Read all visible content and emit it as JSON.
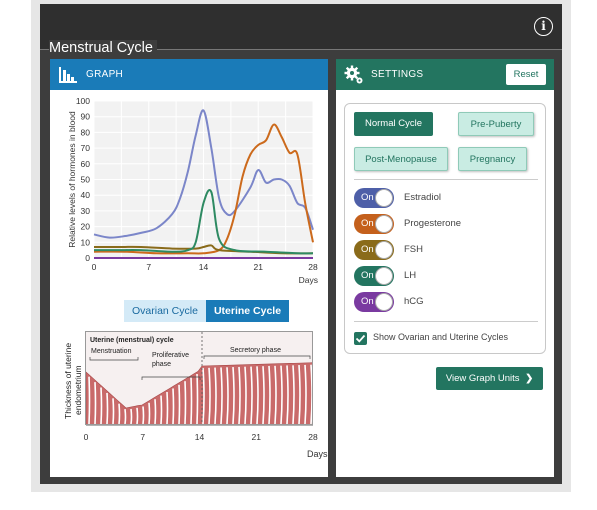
{
  "app": {
    "title": "Menstrual Cycle",
    "info_icon": "info-icon"
  },
  "graph_panel": {
    "header": "GRAPH",
    "icon": "bar-chart-icon",
    "tabs": [
      {
        "label": "Ovarian Cycle",
        "active": false
      },
      {
        "label": "Uterine Cycle",
        "active": true
      }
    ],
    "uterine_figure": {
      "title": "Uterine (menstrual) cycle",
      "phases": [
        "Menstruation",
        "Proliferative phase",
        "Secretory phase"
      ],
      "ylabel_line1": "Thickness of uterine",
      "ylabel_line2": "endometrium",
      "x_ticks": [
        "0",
        "7",
        "14",
        "21",
        "28"
      ],
      "xlabel": "Days"
    }
  },
  "chart_data": {
    "type": "line",
    "ylabel": "Relative levels of hormones in blood",
    "xlabel": "Days",
    "xlim": [
      0,
      28
    ],
    "ylim": [
      0,
      100
    ],
    "x_ticks": [
      0,
      7,
      14,
      21,
      28
    ],
    "y_ticks": [
      0,
      10,
      20,
      30,
      40,
      50,
      60,
      70,
      80,
      90,
      100
    ],
    "grid": true,
    "series": [
      {
        "color": "#7b86c9",
        "x": [
          0,
          2,
          4,
          6,
          8,
          10,
          11,
          12,
          13,
          14,
          15,
          16,
          17,
          18,
          20,
          21,
          22,
          23,
          24,
          25,
          26,
          27,
          28
        ],
        "y": [
          15,
          13,
          14,
          16,
          19,
          28,
          38,
          55,
          78,
          94,
          70,
          38,
          28,
          30,
          45,
          56,
          48,
          50,
          50,
          46,
          35,
          32,
          18
        ]
      },
      {
        "color": "#cc6a1c",
        "x": [
          0,
          4,
          8,
          12,
          14,
          16,
          17,
          18,
          19,
          20,
          21,
          22,
          23,
          24,
          25,
          26,
          27,
          28
        ],
        "y": [
          4,
          4,
          3,
          3,
          3,
          5,
          12,
          28,
          52,
          66,
          72,
          75,
          85,
          77,
          67,
          66,
          35,
          10
        ]
      },
      {
        "color": "#8a6b1a",
        "x": [
          0,
          3,
          6,
          10,
          13,
          14,
          15,
          16,
          20,
          24,
          28
        ],
        "y": [
          7,
          7,
          7,
          6,
          6,
          7,
          8,
          5,
          4,
          3,
          3
        ]
      },
      {
        "color": "#2e8a62",
        "x": [
          0,
          3,
          6,
          10,
          12,
          13,
          14,
          15,
          16,
          18,
          22,
          26,
          28
        ],
        "y": [
          5,
          5,
          5,
          4,
          5,
          10,
          35,
          42,
          12,
          5,
          4,
          3,
          3
        ]
      },
      {
        "color": "#7a3aa0",
        "x": [
          0,
          28
        ],
        "y": [
          0,
          0
        ]
      }
    ]
  },
  "settings_panel": {
    "header": "SETTINGS",
    "icon": "gear-icon",
    "reset_label": "Reset",
    "presets": [
      {
        "label": "Normal Cycle",
        "selected": true
      },
      {
        "label": "Pre-Puberty",
        "selected": false
      },
      {
        "label": "Post-Menopause",
        "selected": false
      },
      {
        "label": "Pregnancy",
        "selected": false
      }
    ],
    "toggles": [
      {
        "label": "Estradiol",
        "state": "On",
        "color": "#4e5fa8"
      },
      {
        "label": "Progesterone",
        "state": "On",
        "color": "#c4601c"
      },
      {
        "label": "FSH",
        "state": "On",
        "color": "#8a6b1a"
      },
      {
        "label": "LH",
        "state": "On",
        "color": "#237560"
      },
      {
        "label": "hCG",
        "state": "On",
        "color": "#7a3aa0"
      }
    ],
    "show_cycles_label": "Show Ovarian and Uterine Cycles",
    "show_cycles_checked": true,
    "view_units_label": "View Graph Units",
    "view_units_icon": "chevron-right-icon"
  },
  "colors": {
    "graph_header": "#1a7bb8",
    "settings_header": "#237560",
    "app_bg": "#3d3d3d"
  }
}
